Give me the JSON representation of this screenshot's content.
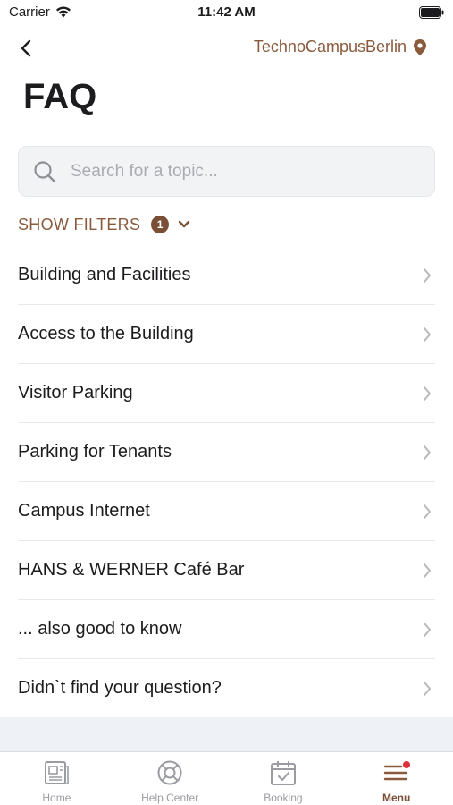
{
  "status_bar": {
    "carrier": "Carrier",
    "time": "11:42 AM"
  },
  "header": {
    "location": "TechnoCampusBerlin",
    "title": "FAQ"
  },
  "search": {
    "placeholder": "Search for a topic...",
    "value": ""
  },
  "filters": {
    "label": "SHOW FILTERS",
    "count": "1"
  },
  "topics": [
    {
      "label": "Building and Facilities"
    },
    {
      "label": "Access to the Building"
    },
    {
      "label": "Visitor Parking"
    },
    {
      "label": "Parking for Tenants"
    },
    {
      "label": "Campus Internet"
    },
    {
      "label": "HANS & WERNER Café Bar"
    },
    {
      "label": "... also good to know"
    },
    {
      "label": "Didn`t find your question?"
    }
  ],
  "tabbar": {
    "tabs": [
      {
        "label": "Home",
        "icon": "home-icon"
      },
      {
        "label": "Help Center",
        "icon": "help-center-icon"
      },
      {
        "label": "Booking",
        "icon": "calendar-icon"
      },
      {
        "label": "Menu",
        "icon": "menu-icon",
        "active": true
      }
    ]
  },
  "colors": {
    "accent": "#8a5a3c",
    "badge": "#7a4f36",
    "notification_dot": "#e0303a"
  }
}
